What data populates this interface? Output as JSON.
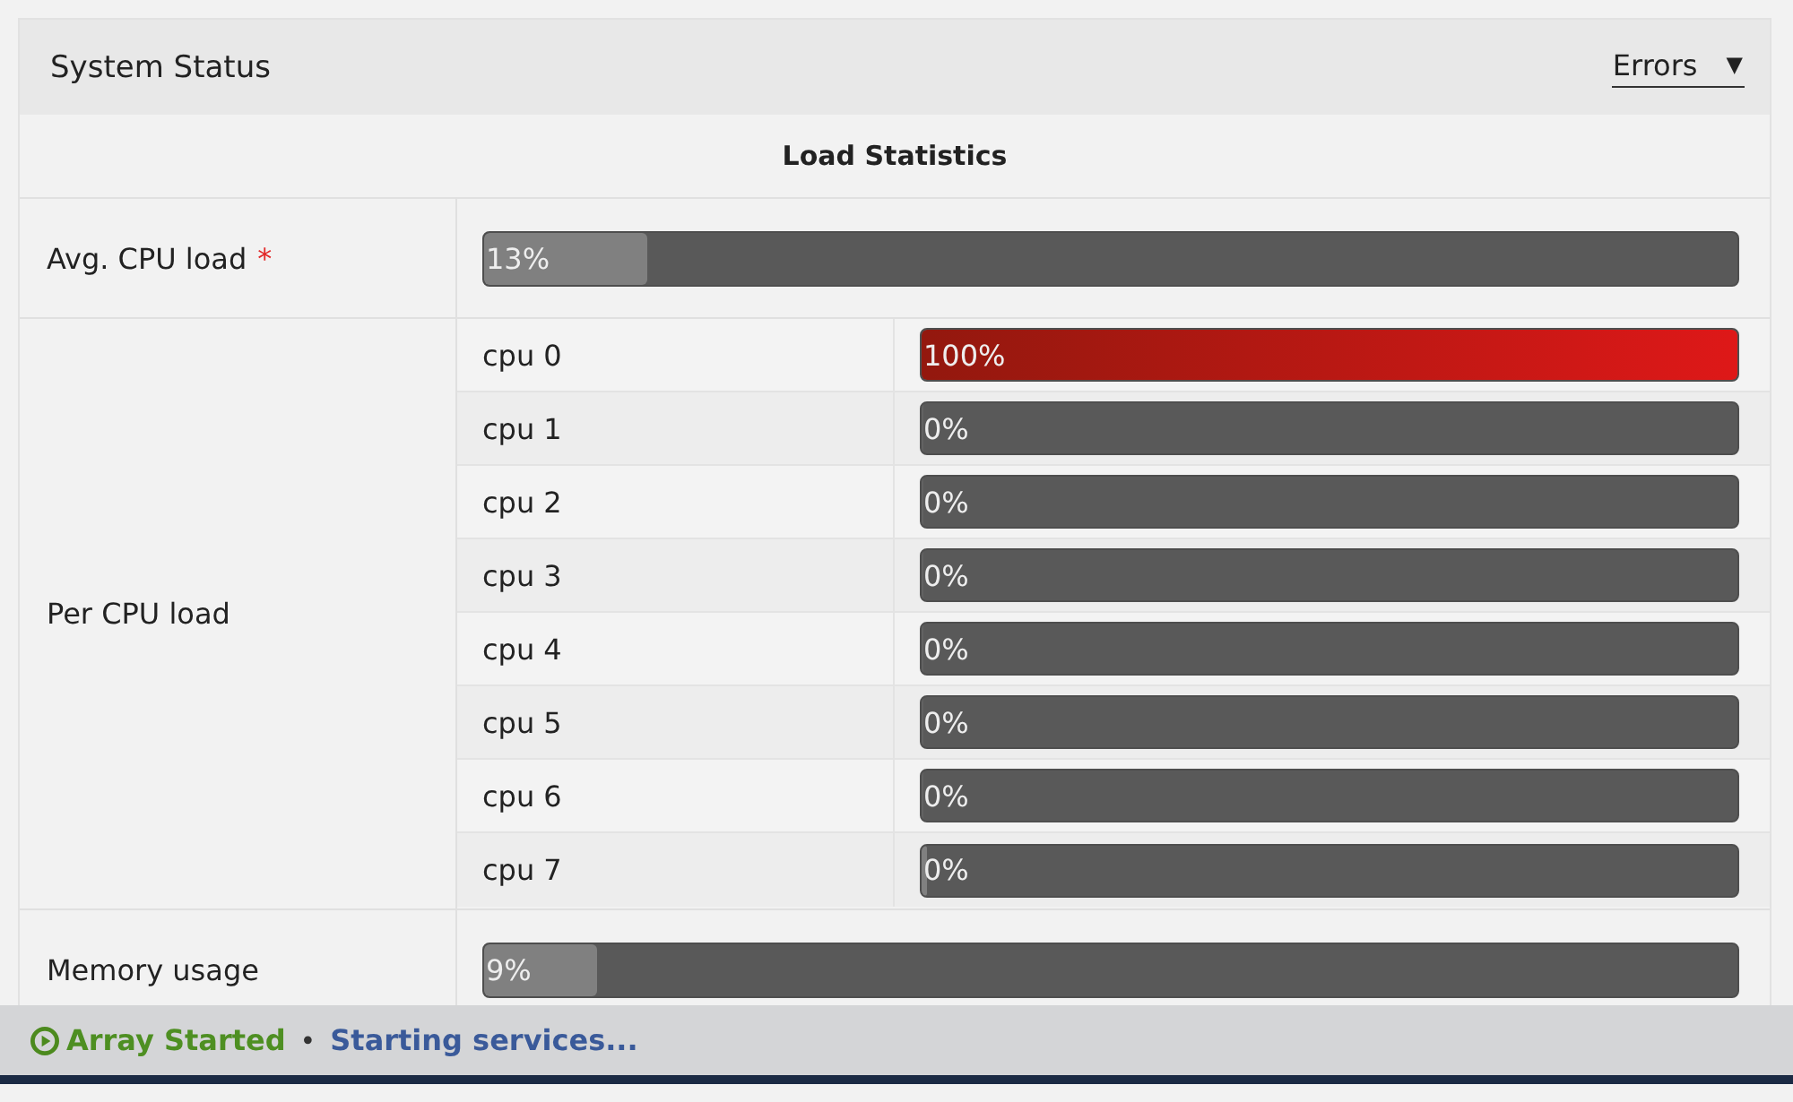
{
  "panel": {
    "title": "System Status",
    "filter": {
      "value": "Errors",
      "caret": "▼"
    }
  },
  "section": {
    "title": "Load Statistics"
  },
  "rows": [
    {
      "kind": "single",
      "label": "Avg. CPU load",
      "mark": "*",
      "meter": {
        "level": 0.13,
        "reading": "13%"
      }
    },
    {
      "kind": "group",
      "label": "Per CPU load",
      "items": [
        {
          "label": "cpu 0",
          "level": 1,
          "reading": "100%"
        },
        {
          "label": "cpu 1",
          "level": 0,
          "reading": "0%"
        },
        {
          "label": "cpu 2",
          "level": 0,
          "reading": "0%"
        },
        {
          "label": "cpu 3",
          "level": 0,
          "reading": "0%"
        },
        {
          "label": "cpu 4",
          "level": 0,
          "reading": "0%"
        },
        {
          "label": "cpu 5",
          "level": 0,
          "reading": "0%"
        },
        {
          "label": "cpu 6",
          "level": 0,
          "reading": "0%"
        },
        {
          "label": "cpu 7",
          "level": 0.006,
          "reading": "0%"
        }
      ]
    },
    {
      "kind": "single",
      "label": "Memory usage",
      "meter": {
        "level": 0.09,
        "reading": "9%"
      }
    }
  ],
  "status_bar": {
    "state": "Array Started",
    "separator": "•",
    "message": "Starting services..."
  }
}
